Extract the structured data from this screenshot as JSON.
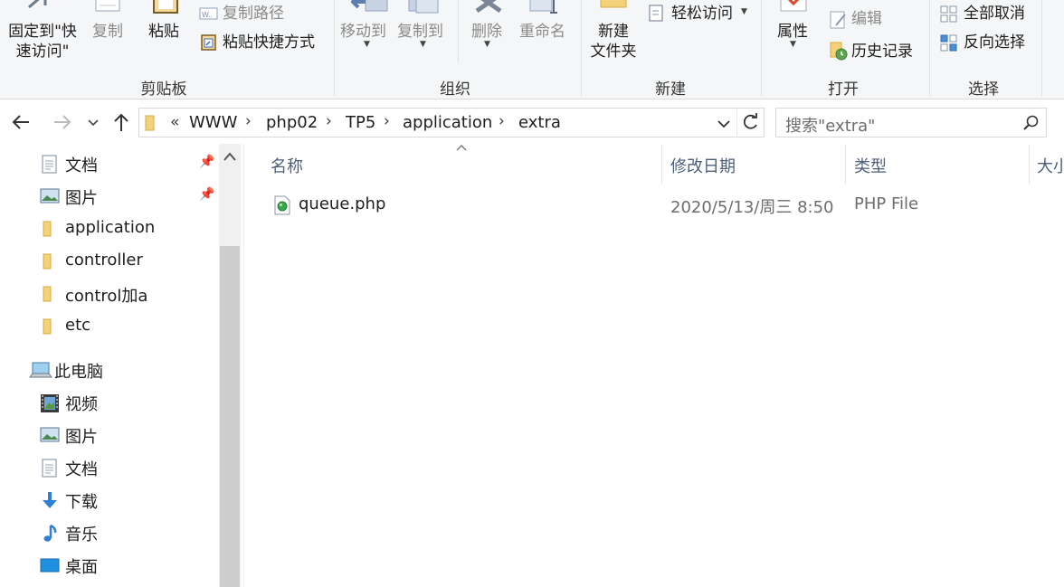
{
  "ribbon": {
    "clipboard": {
      "pin_label_line1": "固定到\"快",
      "pin_label_line2": "速访问\"",
      "copy_label": "复制",
      "paste_label": "粘贴",
      "copy_path_label": "复制路径",
      "paste_shortcut_label": "粘贴快捷方式",
      "group_label": "剪贴板"
    },
    "organize": {
      "move_to_label": "移动到",
      "copy_to_label": "复制到",
      "delete_label": "删除",
      "rename_label": "重命名",
      "group_label": "组织"
    },
    "new": {
      "new_folder_line1": "新建",
      "new_folder_line2": "文件夹",
      "easy_access_label": "轻松访问",
      "group_label": "新建"
    },
    "open": {
      "properties_label": "属性",
      "edit_label": "编辑",
      "history_label": "历史记录",
      "group_label": "打开"
    },
    "select": {
      "select_none_label": "全部取消",
      "invert_selection_label": "反向选择",
      "group_label": "选择"
    }
  },
  "address_bar": {
    "overflow": "«",
    "crumbs": [
      "WWW",
      "php02",
      "TP5",
      "application",
      "extra"
    ],
    "separator": "›"
  },
  "search": {
    "placeholder": "搜索\"extra\""
  },
  "nav_pane": {
    "quick_access": [
      {
        "label": "文档",
        "icon": "document-icon",
        "pinned": true
      },
      {
        "label": "图片",
        "icon": "picture-icon",
        "pinned": true
      },
      {
        "label": "application",
        "icon": "folder-icon",
        "pinned": false
      },
      {
        "label": "controller",
        "icon": "folder-icon",
        "pinned": false
      },
      {
        "label": "control加a",
        "icon": "folder-icon",
        "pinned": false
      },
      {
        "label": "etc",
        "icon": "folder-icon",
        "pinned": false
      }
    ],
    "this_pc": {
      "label": "此电脑",
      "icon": "computer-icon"
    },
    "pc_items": [
      {
        "label": "视频",
        "icon": "video-icon"
      },
      {
        "label": "图片",
        "icon": "picture-icon"
      },
      {
        "label": "文档",
        "icon": "document-icon"
      },
      {
        "label": "下载",
        "icon": "download-icon"
      },
      {
        "label": "音乐",
        "icon": "music-icon"
      },
      {
        "label": "桌面",
        "icon": "desktop-icon"
      }
    ]
  },
  "file_list": {
    "columns": {
      "name": "名称",
      "modified": "修改日期",
      "type": "类型",
      "size": "大小"
    },
    "rows": [
      {
        "name": "queue.php",
        "modified": "2020/5/13/周三 8:50",
        "type": "PHP File"
      }
    ]
  },
  "colors": {
    "folder": "#e8c25a",
    "header_text": "#4c607a",
    "meta_text": "#6d6d6d"
  }
}
